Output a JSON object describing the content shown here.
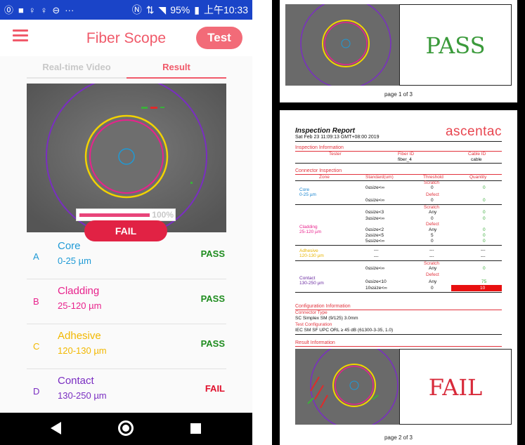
{
  "status_bar": {
    "battery": "95%",
    "time": "上午10:33"
  },
  "app": {
    "title": "Fiber Scope",
    "test_button": "Test",
    "tabs": [
      "Real-time Video",
      "Result"
    ],
    "progress_percent": 100,
    "progress_label": "100%",
    "result_badge": "FAIL",
    "zones": [
      {
        "letter": "A",
        "name": "Core",
        "range": "0-25 µm",
        "status": "PASS",
        "color": "#1f9ad6",
        "status_color": "#1e8c1e"
      },
      {
        "letter": "B",
        "name": "Cladding",
        "range": "25-120 µm",
        "status": "PASS",
        "color": "#e8228c",
        "status_color": "#1e8c1e"
      },
      {
        "letter": "C",
        "name": "Adhesive",
        "range": "120-130 µm",
        "status": "PASS",
        "color": "#f2b800",
        "status_color": "#1e8c1e"
      },
      {
        "letter": "D",
        "name": "Contact",
        "range": "130-250 µm",
        "status": "FAIL",
        "color": "#7a2ec2",
        "status_color": "#e0102c"
      }
    ]
  },
  "report": {
    "page1": {
      "verdict": "PASS",
      "page_label": "page 1 of 3"
    },
    "page2": {
      "title": "Inspection Report",
      "date": "Sat Feb 23 11:09:13 GMT+08:00 2019",
      "logo": "ascentac",
      "inspection_info": {
        "heading": "Inspection Information",
        "headers": [
          "Tester",
          "Fiber ID",
          "Cable ID"
        ],
        "values": [
          "",
          "fiber_4",
          "cable"
        ]
      },
      "connector_inspection": {
        "heading": "Connector Inspection",
        "headers": [
          "Zone",
          "Standard(um)",
          "Threshold",
          "Quantity"
        ],
        "scratch_label": "Scratch",
        "defect_label": "Defect",
        "core": {
          "name": "Core",
          "range": "0-25 µm",
          "scratch": [
            [
              "0≤size<∞",
              "0",
              "0"
            ]
          ],
          "defect": [
            [
              "0≤size<∞",
              "0",
              "0"
            ]
          ]
        },
        "cladding": {
          "name": "Cladding",
          "range": "25-120 µm",
          "scratch": [
            [
              "0≤size<3",
              "Any",
              "0"
            ],
            [
              "3≤size<∞",
              "0",
              "0"
            ]
          ],
          "defect": [
            [
              "0≤size<2",
              "Any",
              "0"
            ],
            [
              "2≤size<5",
              "5",
              "0"
            ],
            [
              "5≤size<∞",
              "0",
              "0"
            ]
          ]
        },
        "adhesive": {
          "name": "Adhesive",
          "range": "120-130 µm",
          "rows": [
            [
              "---",
              "---",
              "---"
            ],
            [
              "---",
              "---",
              "---"
            ]
          ]
        },
        "contact": {
          "name": "Contact",
          "range": "130-250 µm",
          "scratch": [
            [
              "0≤size<∞",
              "Any",
              "0"
            ]
          ],
          "defect": [
            [
              "0≤size<10",
              "Any",
              "75"
            ],
            [
              "10≤size<∞",
              "0",
              "10"
            ]
          ]
        }
      },
      "configuration": {
        "heading": "Configuration Information",
        "connector_type_label": "Connector Type",
        "connector_type": "SC Simplex SM (9/125) 3.0mm",
        "test_config_label": "Test Configuration",
        "test_config": "IEC SM SF UPC ORL ≥ 45 dB (61300-3-35, 1.0)"
      },
      "result_info_heading": "Result Information",
      "verdict": "FAIL",
      "page_label": "page 2 of 3"
    }
  },
  "colors": {
    "status_bar": "#1a44c8",
    "accent": "#f05a6a",
    "fail_red": "#e12244",
    "pass_green": "#3a9a3a"
  }
}
